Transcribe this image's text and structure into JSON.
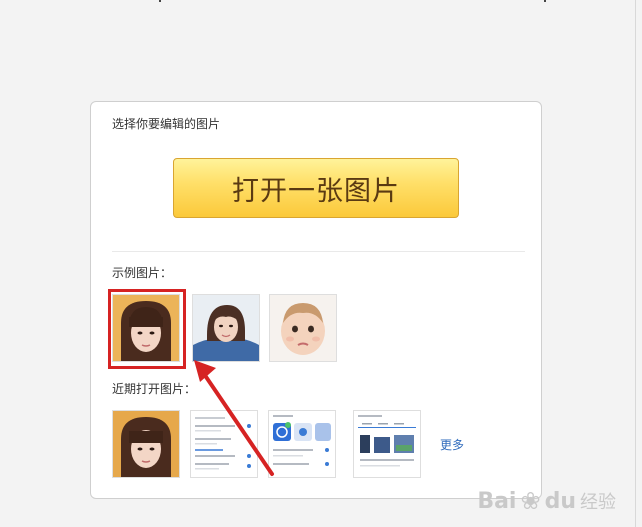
{
  "dialog": {
    "title": "选择你要编辑的图片",
    "open_button_label": "打开一张图片",
    "samples_label": "示例图片：",
    "recent_label": "近期打开图片：",
    "more_label": "更多"
  },
  "watermark": {
    "brand": "Bai",
    "brand_tail": "du",
    "suffix": "经验",
    "color": "#c9c9c9"
  },
  "colors": {
    "highlight": "#d62323",
    "button_gradient_top": "#fff39a",
    "button_gradient_bottom": "#fbc93a",
    "link": "#2f6bbd"
  },
  "sample_images": [
    {
      "name": "sample-girl-bangs"
    },
    {
      "name": "sample-girl-denim"
    },
    {
      "name": "sample-baby"
    }
  ],
  "recent_images": [
    {
      "name": "recent-girl-bangs"
    },
    {
      "name": "recent-settings-screenshot"
    },
    {
      "name": "recent-app-screenshot"
    },
    {
      "name": "recent-tablet-screenshot"
    }
  ]
}
